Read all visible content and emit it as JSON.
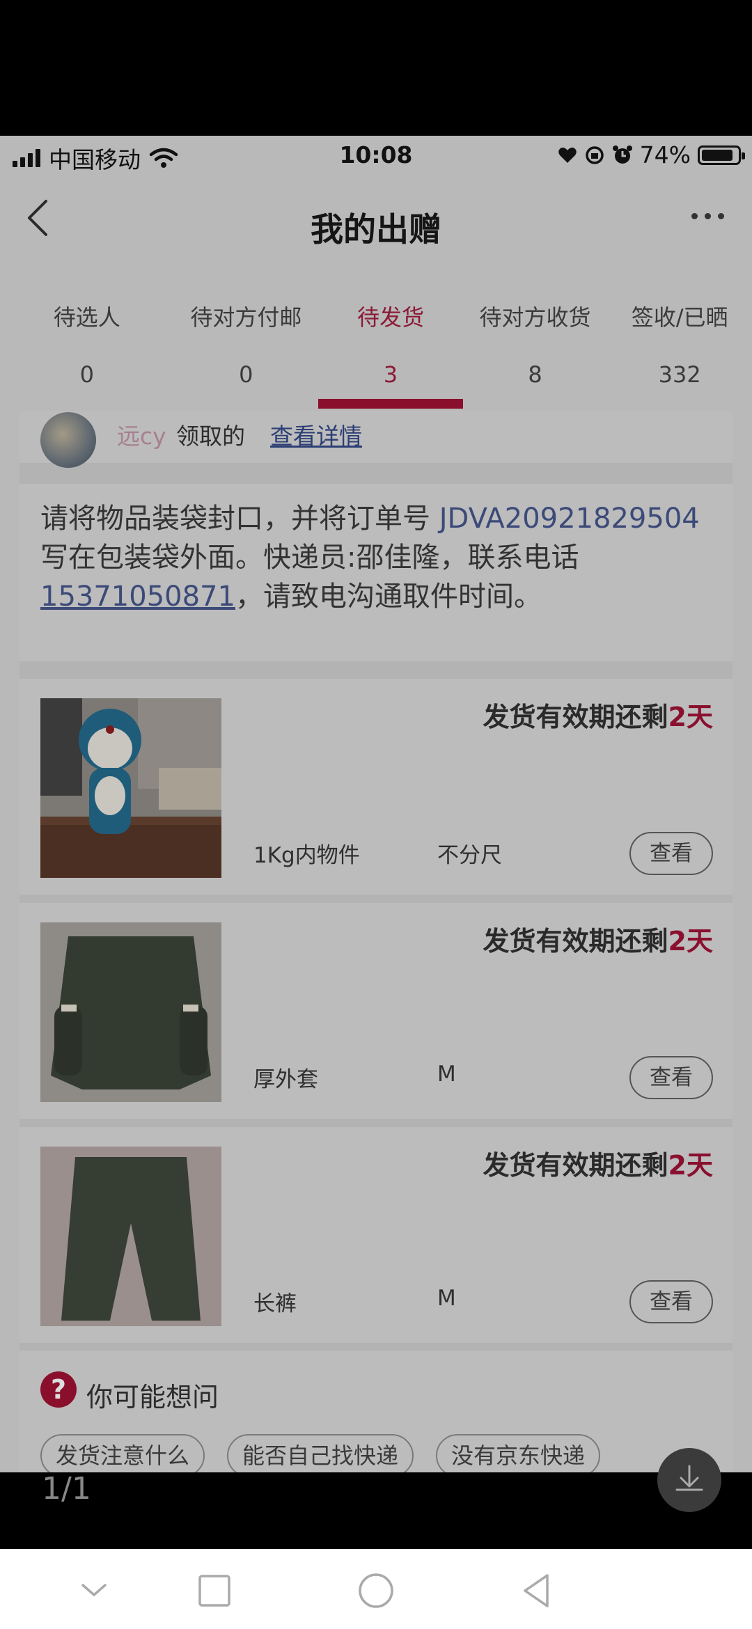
{
  "status_bar": {
    "carrier": "中国移动",
    "time": "10:08",
    "battery": "74%"
  },
  "header": {
    "title": "我的出赠"
  },
  "tabs": [
    {
      "label": "待选人",
      "count": "0",
      "active": false
    },
    {
      "label": "待对方付邮",
      "count": "0",
      "active": false
    },
    {
      "label": "待发货",
      "count": "3",
      "active": true
    },
    {
      "label": "待对方收货",
      "count": "8",
      "active": false
    },
    {
      "label": "签收/已晒",
      "count": "332",
      "active": false
    }
  ],
  "claimer": {
    "name": "远cy",
    "text": "领取的",
    "link": "查看详情"
  },
  "notice": {
    "part1": "请将物品装袋封口，并将订单号 ",
    "order_no": "JDVA20921829504",
    "part2": " 写在包装袋外面。快递员:邵佳隆，联系电话",
    "phone": "15371050871",
    "part3": "，请致电沟通取件时间。"
  },
  "items": [
    {
      "deadline_prefix": "发货有效期还剩",
      "days": "2天",
      "name": "1Kg内物件",
      "size": "不分尺",
      "action": "查看"
    },
    {
      "deadline_prefix": "发货有效期还剩",
      "days": "2天",
      "name": "厚外套",
      "size": "M",
      "action": "查看"
    },
    {
      "deadline_prefix": "发货有效期还剩",
      "days": "2天",
      "name": "长裤",
      "size": "M",
      "action": "查看"
    }
  ],
  "faq": {
    "icon": "?",
    "title": "你可能想问",
    "chips": [
      "发货注意什么",
      "能否自己找快递",
      "没有京东快递"
    ]
  },
  "viewer": {
    "counter": "1/1"
  },
  "colors": {
    "accent": "#8a0f2c",
    "overlay_bg": "#b9b9b9"
  }
}
